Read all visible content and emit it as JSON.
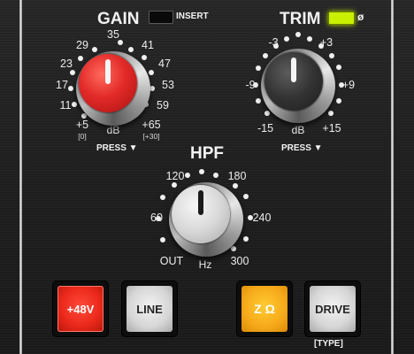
{
  "gain": {
    "title": "GAIN",
    "insert_label": "INSERT",
    "ticks": [
      "35",
      "41",
      "47",
      "53",
      "59",
      "+65",
      "+5",
      "11",
      "17",
      "23",
      "29"
    ],
    "plus5_sub": "[0]",
    "plus65_sub": "[+30]",
    "unit": "dB",
    "press": "PRESS ▼"
  },
  "trim": {
    "title": "TRIM",
    "phase_label": "ø",
    "ticks": [
      "-3",
      "+3",
      "+9",
      "+15",
      "-15",
      "-9"
    ],
    "unit": "dB",
    "press": "PRESS ▼"
  },
  "hpf": {
    "title": "HPF",
    "ticks": [
      "120",
      "180",
      "240",
      "300",
      "OUT",
      "60"
    ],
    "unit": "Hz"
  },
  "buttons": {
    "phantom": "+48V",
    "line": "LINE",
    "impedance": "Z Ω",
    "drive": "DRIVE",
    "drive_type": "[TYPE]"
  },
  "colors": {
    "gain_knob": "#e22a28",
    "trim_knob": "#2f2f2f",
    "hpf_knob": "#d8d8d8",
    "phase_led": "#c8f000",
    "phantom_button": "#ec2a1c",
    "impedance_button": "#f6a91a"
  }
}
